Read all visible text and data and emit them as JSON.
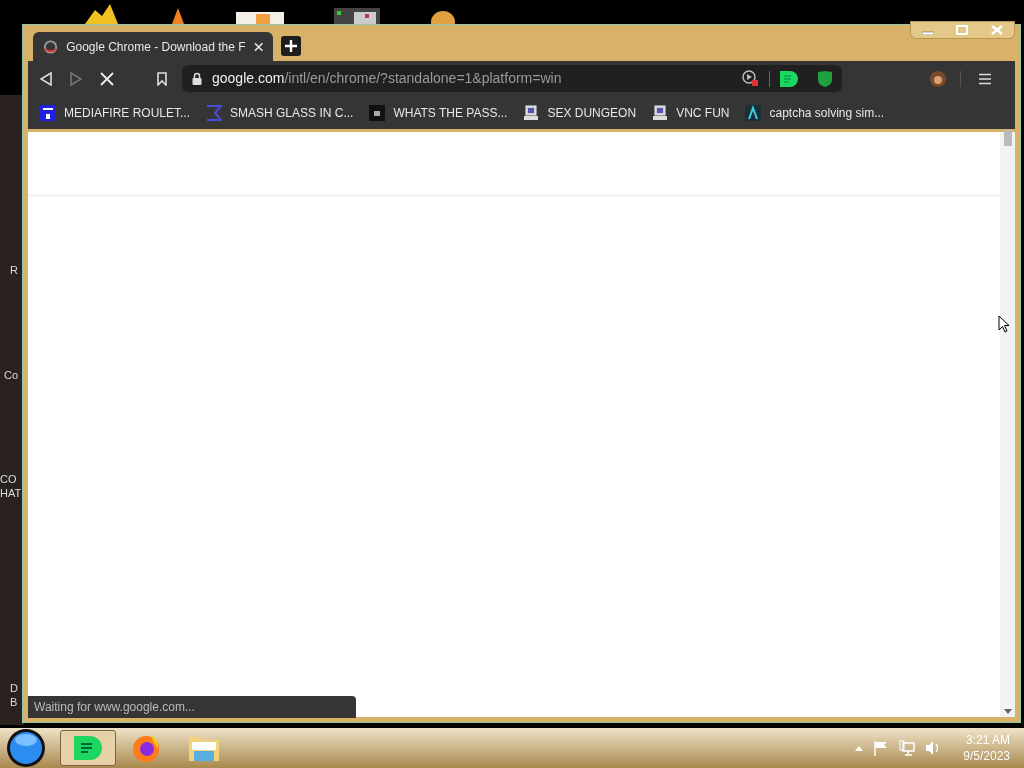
{
  "desktop": {
    "fragments": [
      "R",
      "Co",
      "CO",
      "HAT",
      "D",
      "B"
    ]
  },
  "window": {
    "tab": {
      "title": "Google Chrome - Download the F",
      "selected": true
    },
    "address": {
      "host": "google.com",
      "path": "/intl/en/chrome/?standalone=1&platform=win"
    },
    "loading": true,
    "bookmarks": [
      {
        "label": "MEDIAFIRE ROULET...",
        "kind": "mf"
      },
      {
        "label": "SMASH GLASS IN C...",
        "kind": "sigma"
      },
      {
        "label": "WHATS THE PASS...",
        "kind": "dark"
      },
      {
        "label": "SEX DUNGEON",
        "kind": "pc"
      },
      {
        "label": "VNC FUN",
        "kind": "pc"
      },
      {
        "label": "captcha solving sim...",
        "kind": "lambda"
      }
    ],
    "status": "Waiting for www.google.com..."
  },
  "taskbar": {
    "apps": [
      {
        "kind": "chat",
        "selected": true
      },
      {
        "kind": "firefox",
        "selected": false
      },
      {
        "kind": "folder",
        "selected": false
      }
    ],
    "time": "3:21 AM",
    "date": "9/5/2023"
  }
}
